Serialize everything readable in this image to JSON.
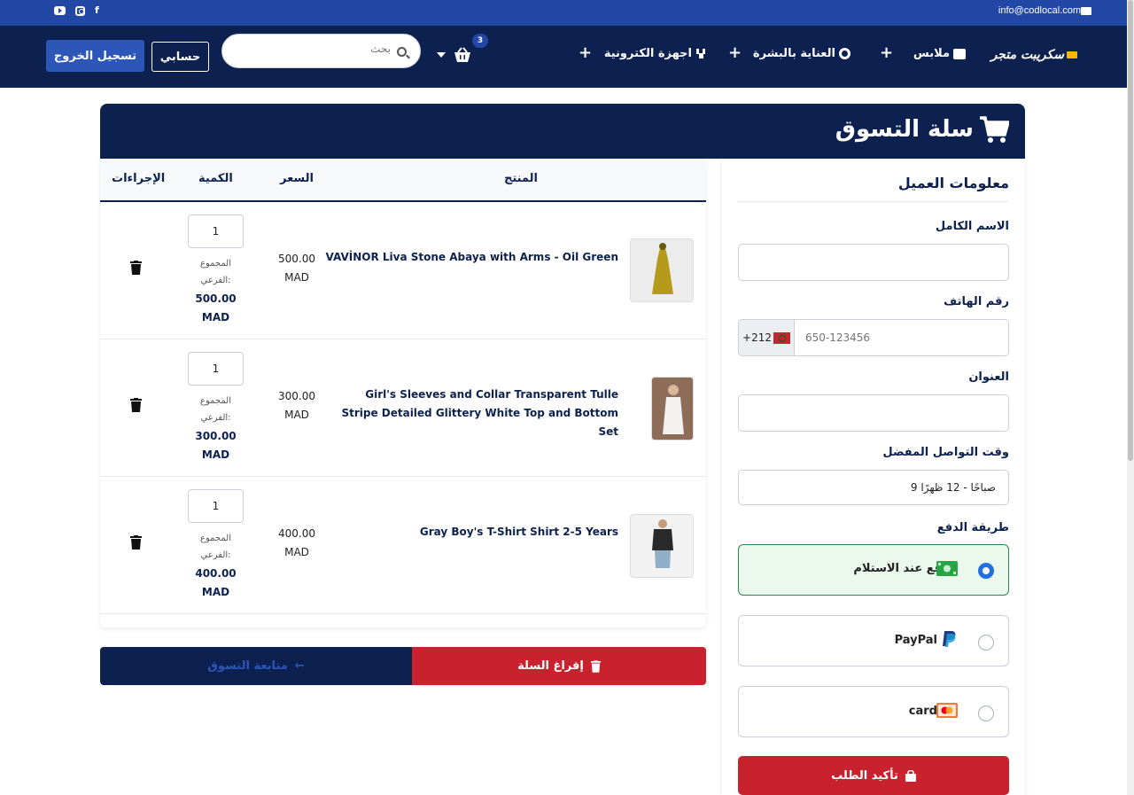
{
  "topbar": {
    "email": "info@codlocal.com",
    "social": [
      "youtube-icon",
      "instagram-icon",
      "facebook-icon"
    ]
  },
  "nav": {
    "logo": "سكريبت متجر",
    "menu": [
      {
        "label": "ملابس",
        "icon": "shirt-icon"
      },
      {
        "label": "العناية بالبشرة",
        "icon": "skincare-icon"
      },
      {
        "label": "اجهزة الكترونية",
        "icon": "electronics-icon"
      }
    ],
    "plus": "+",
    "cart_count": "3",
    "search_placeholder": "بحث",
    "account_label": "حسابي",
    "logout_label": "تسجيل الخروج"
  },
  "cart": {
    "title": "سلة التسوق",
    "headers": {
      "product": "المنتج",
      "price": "السعر",
      "quantity": "الكمية",
      "actions": "الإجراءات"
    },
    "subtotal_label": "المجموع الفرعي:",
    "items": [
      {
        "name": "VAVİNOR Liva Stone Abaya with Arms - Oil Green",
        "price": "500.00",
        "currency": "MAD",
        "qty": "1",
        "subtotal": "500.00"
      },
      {
        "name": "Girl's Sleeves and Collar Transparent Tulle Stripe Detailed Glittery White Top and Bottom Set",
        "price": "300.00",
        "currency": "MAD",
        "qty": "1",
        "subtotal": "300.00"
      },
      {
        "name": "Gray Boy's T-Shirt Shirt 2-5 Years",
        "price": "400.00",
        "currency": "MAD",
        "qty": "1",
        "subtotal": "400.00"
      }
    ],
    "continue_label": "متابعة التسوق",
    "empty_label": "إفراغ السلة"
  },
  "customer": {
    "title": "معلومات العميل",
    "name_label": "الاسم الكامل",
    "phone_label": "رقم الهاتف",
    "phone_prefix": "+212",
    "phone_placeholder": "650-123456",
    "address_label": "العنوان",
    "contact_time_label": "وقت التواصل المفضل",
    "contact_time_value": "9 صباحًا - 12 ظهرًا",
    "payment_label": "طريقة الدفع",
    "payments": [
      {
        "label": "الدفع عند الاستلام",
        "icon": "cash-icon",
        "selected": true
      },
      {
        "label": "PayPal",
        "icon": "paypal-icon",
        "selected": false
      },
      {
        "label": "card",
        "icon": "mastercard-icon",
        "selected": false
      }
    ],
    "confirm_label": "تأكيد الطلب"
  },
  "colors": {
    "navy": "#0d2150",
    "blue": "#2347a5",
    "red": "#c8222f",
    "green_bg": "#eaf8ee"
  }
}
